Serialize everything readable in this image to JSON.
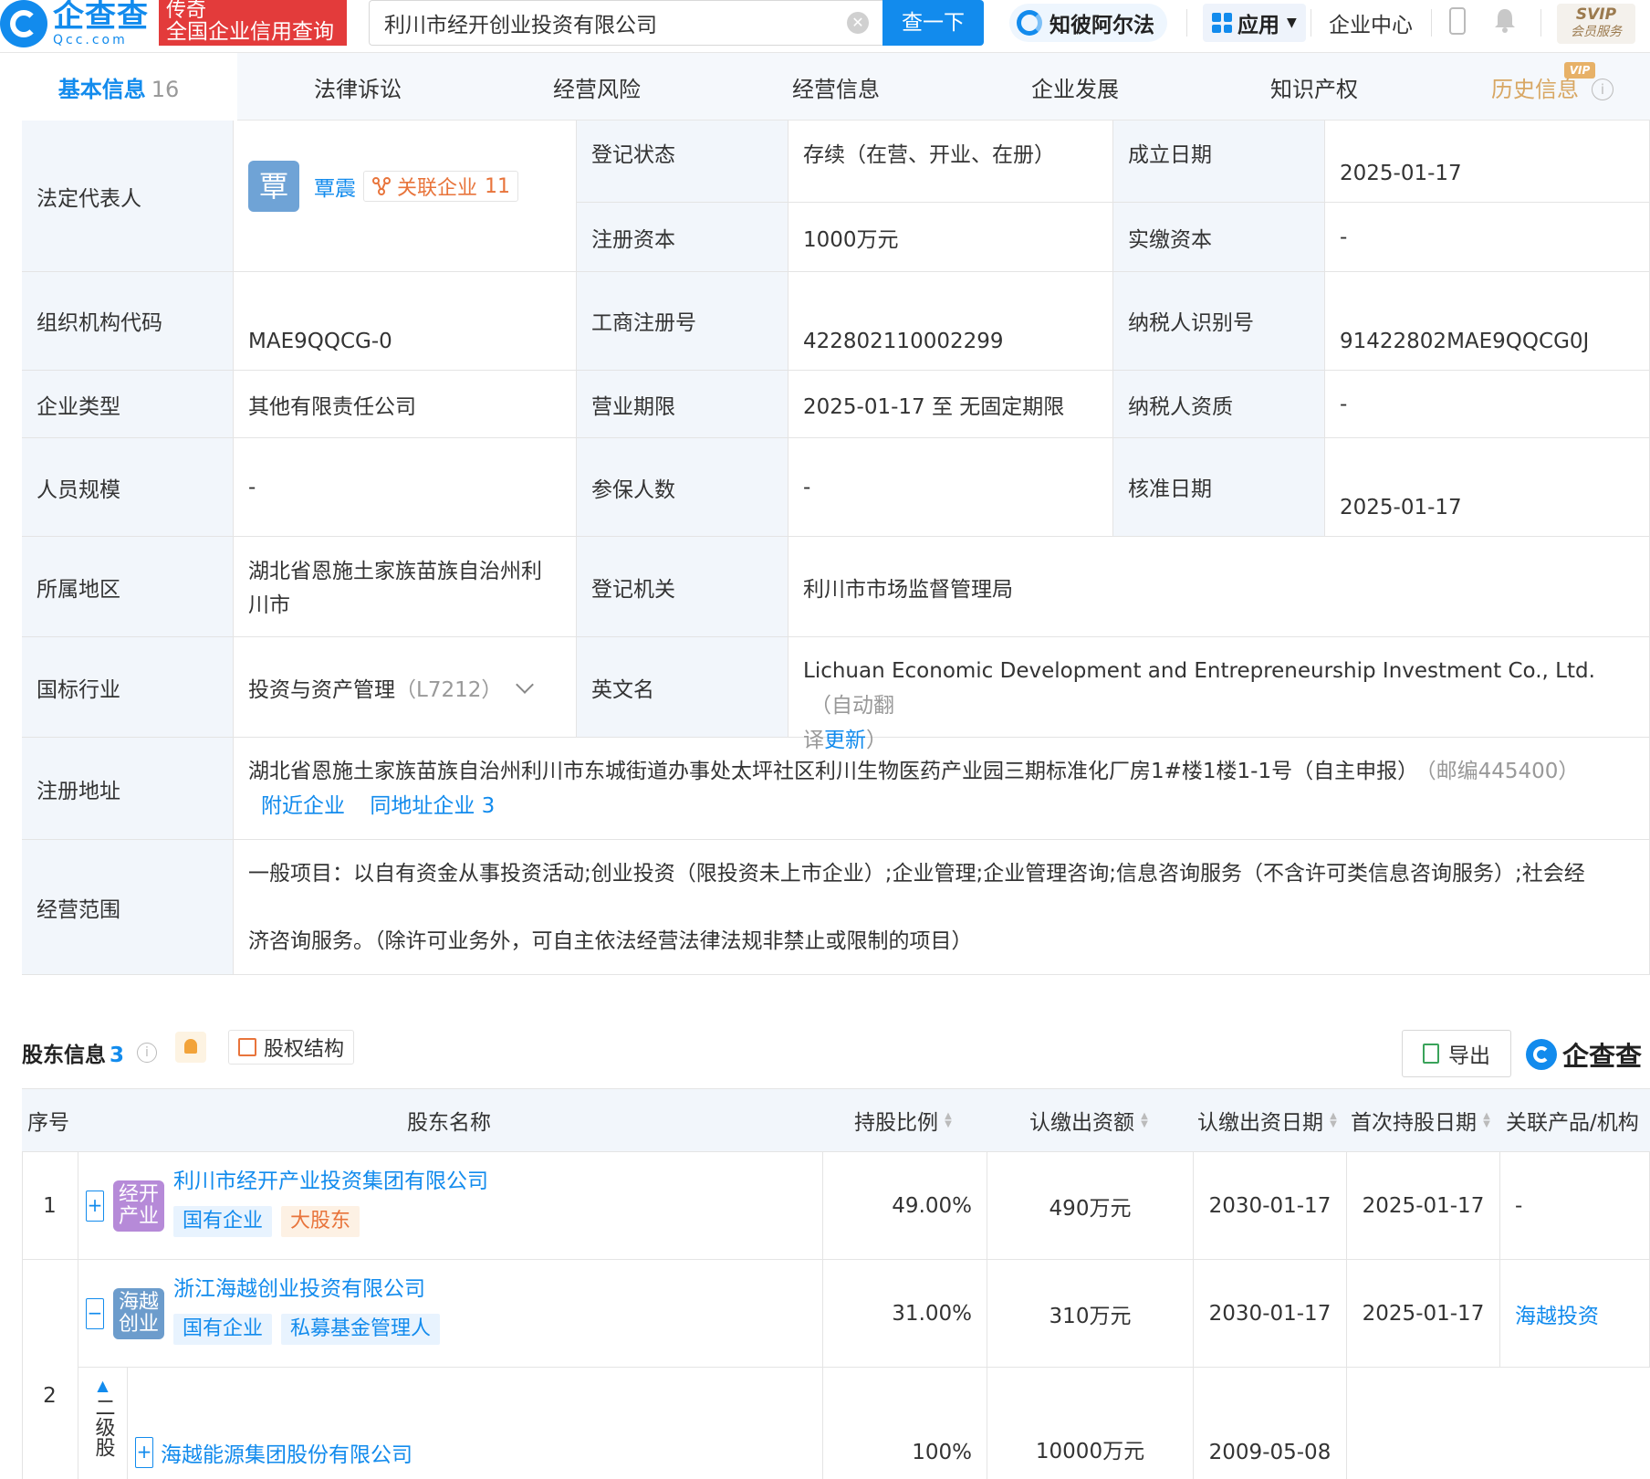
{
  "header": {
    "logo_cn": "企查查",
    "logo_en": "Qcc.com",
    "promo_line1": "传奇",
    "promo_line2": "全国企业信用查询",
    "search_value": "利川市经开创业投资有限公司",
    "search_button": "查一下",
    "zhibi_label": "知彼阿尔法",
    "apps_label": "应用",
    "enterprise_center": "企业中心",
    "svip_line1": "SVIP",
    "svip_line2": "会员服务"
  },
  "tabs": [
    {
      "label": "基本信息",
      "count": "16"
    },
    {
      "label": "法律诉讼"
    },
    {
      "label": "经营风险"
    },
    {
      "label": "经营信息"
    },
    {
      "label": "企业发展"
    },
    {
      "label": "知识产权"
    },
    {
      "label": "历史信息",
      "badge": "VIP"
    }
  ],
  "info": {
    "legal_rep_label": "法定代表人",
    "legal_rep_avatar": "覃",
    "legal_rep_name": "覃震",
    "related_label": "关联企业",
    "related_count": "11",
    "reg_status_label": "登记状态",
    "reg_status": "存续（在营、开业、在册）",
    "est_date_label": "成立日期",
    "est_date": "2025-01-17",
    "reg_capital_label": "注册资本",
    "reg_capital": "1000万元",
    "paid_capital_label": "实缴资本",
    "paid_capital": "-",
    "org_code_label": "组织机构代码",
    "org_code": "MAE9QQCG-0",
    "biz_reg_no_label": "工商注册号",
    "biz_reg_no": "422802110002299",
    "taxpayer_id_label": "纳税人识别号",
    "taxpayer_id": "91422802MAE9QQCG0J",
    "company_type_label": "企业类型",
    "company_type": "其他有限责任公司",
    "biz_term_label": "营业期限",
    "biz_term": "2025-01-17 至 无固定期限",
    "taxpayer_qual_label": "纳税人资质",
    "taxpayer_qual": "-",
    "staff_size_label": "人员规模",
    "staff_size": "-",
    "insured_label": "参保人数",
    "insured": "-",
    "approve_date_label": "核准日期",
    "approve_date": "2025-01-17",
    "region_label": "所属地区",
    "region_line1": "湖北省恩施土家族苗族自治州利",
    "region_line2": "川市",
    "reg_authority_label": "登记机关",
    "reg_authority": "利川市市场监督管理局",
    "industry_label": "国标行业",
    "industry": "投资与资产管理",
    "industry_code": "（L7212）",
    "english_name_label": "英文名",
    "english_name": "Lichuan Economic Development and Entrepreneurship Investment Co., Ltd.",
    "english_note_a": "（自动翻",
    "english_note_b": "译",
    "english_note_link": "更新",
    "english_note_c": "）",
    "address_label": "注册地址",
    "address": "湖北省恩施土家族苗族自治州利川市东城街道办事处太坪社区利川生物医药产业园三期标准化厂房1#楼1楼1-1号（自主申报）",
    "postcode": "（邮编445400）",
    "nearby_link": "附近企业",
    "same_addr_link": "同地址企业",
    "same_addr_count": "3",
    "scope_label": "经营范围",
    "scope_line1": "一般项目：以自有资金从事投资活动;创业投资（限投资未上市企业）;企业管理;企业管理咨询;信息咨询服务（不含许可类信息咨询服务）;社会经",
    "scope_line2": "济咨询服务。（除许可业务外，可自主依法经营法律法规非禁止或限制的项目）"
  },
  "shareholders": {
    "title": "股东信息",
    "count": "3",
    "equity_button": "股权结构",
    "export_button": "导出",
    "brand": "企查查",
    "columns": [
      "序号",
      "股东名称",
      "持股比例",
      "认缴出资额",
      "认缴出资日期",
      "首次持股日期",
      "关联产品/机构"
    ],
    "rows": [
      {
        "index": "1",
        "toggle": "+",
        "logo_line1": "经开",
        "logo_line2": "产业",
        "logo_color": "#b68ad8",
        "name": "利川市经开产业投资集团有限公司",
        "tags": [
          {
            "text": "国有企业",
            "style": "blue"
          },
          {
            "text": "大股东",
            "style": "orange"
          }
        ],
        "ratio": "49.00%",
        "amount": "490万元",
        "sub_date": "2030-01-17",
        "first_date": "2025-01-17",
        "product": "-"
      },
      {
        "index": "2",
        "toggle": "−",
        "logo_line1": "海越",
        "logo_line2": "创业",
        "logo_color": "#6c9ccc",
        "name": "浙江海越创业投资有限公司",
        "tags": [
          {
            "text": "国有企业",
            "style": "blue"
          },
          {
            "text": "私募基金管理人",
            "style": "blue"
          }
        ],
        "ratio": "31.00%",
        "amount": "310万元",
        "sub_date": "2030-01-17",
        "first_date": "2025-01-17",
        "product": "海越投资"
      }
    ],
    "sub_row": {
      "level_label": "二级股",
      "toggle": "+",
      "name": "海越能源集团股份有限公司",
      "ratio": "100%",
      "amount": "10000万元",
      "sub_date": "2009-05-08"
    }
  }
}
